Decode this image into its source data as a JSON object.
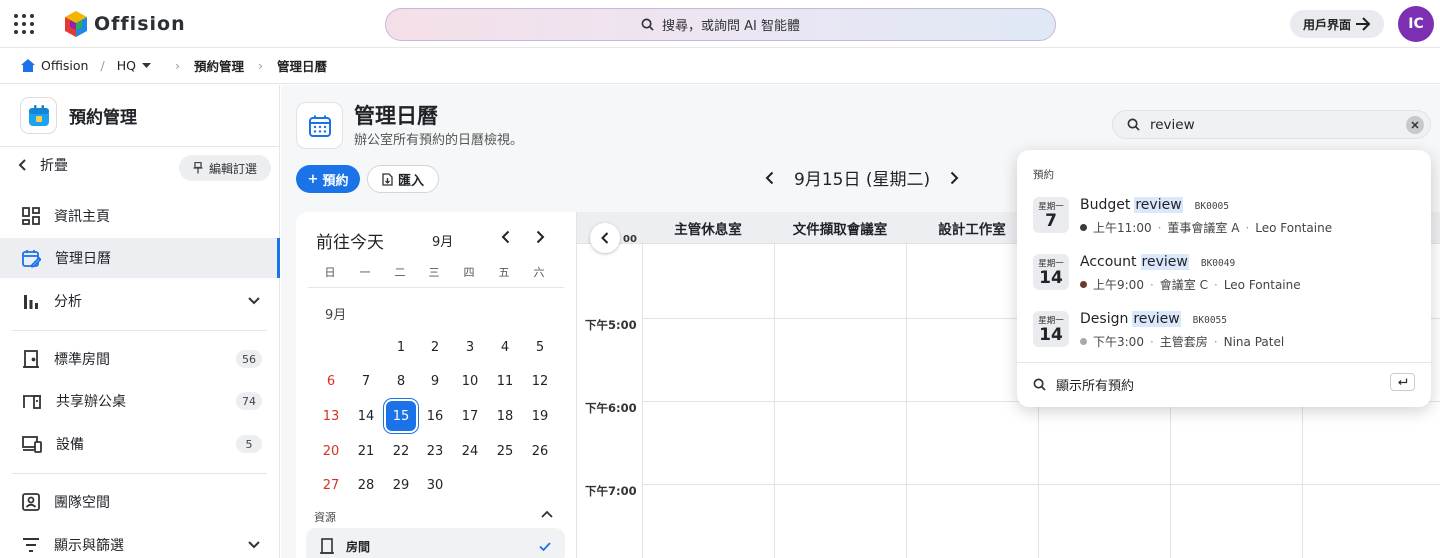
{
  "app": {
    "name": "Offision"
  },
  "global_search": {
    "placeholder": "搜尋，或詢問 AI 智能體"
  },
  "user_view_button": "用戶界面",
  "avatar_initials": "IC",
  "breadcrumb": {
    "home": "Offision",
    "location": "HQ",
    "section": "預約管理",
    "page": "管理日曆"
  },
  "sidebar": {
    "title": "預約管理",
    "collapse_label": "折疊",
    "pin_label": "編輯訂選",
    "nav": [
      {
        "label": "資訊主頁",
        "icon": "dashboard-icon"
      },
      {
        "label": "管理日曆",
        "icon": "calendar-edit-icon",
        "active": true
      },
      {
        "label": "分析",
        "icon": "bar-chart-icon"
      }
    ],
    "resources": [
      {
        "label": "標準房間",
        "count": "56",
        "icon": "door-icon"
      },
      {
        "label": "共享辦公桌",
        "count": "74",
        "icon": "desk-icon"
      },
      {
        "label": "設備",
        "count": "5",
        "icon": "devices-icon"
      }
    ],
    "team_space": "團隊空間",
    "display_filter": "顯示與篩選"
  },
  "page": {
    "title": "管理日曆",
    "subtitle": "辦公室所有預約的日曆檢視。",
    "book_button": "預約",
    "import_button": "匯入",
    "current_date": "9月15日 (星期二)"
  },
  "mini_calendar": {
    "today_label": "前往今天",
    "month": "9月",
    "month_label": "9月",
    "weekdays": [
      "日",
      "一",
      "二",
      "三",
      "四",
      "五",
      "六"
    ],
    "weeks": [
      [
        "",
        "",
        "1",
        "2",
        "3",
        "4",
        "5"
      ],
      [
        "6",
        "7",
        "8",
        "9",
        "10",
        "11",
        "12"
      ],
      [
        "13",
        "14",
        "15",
        "16",
        "17",
        "18",
        "19"
      ],
      [
        "20",
        "21",
        "22",
        "23",
        "24",
        "25",
        "26"
      ],
      [
        "27",
        "28",
        "29",
        "30",
        "",
        "",
        ""
      ]
    ],
    "selected": "15",
    "resources_label": "資源",
    "room_item": "房間"
  },
  "grid": {
    "columns": [
      "主管休息室",
      "文件擷取會議室",
      "設計工作室"
    ],
    "times": [
      "下午5:00",
      "下午6:00",
      "下午7:00"
    ],
    "partial_time": "00"
  },
  "search": {
    "query": "review",
    "section_label": "預約",
    "results": [
      {
        "weekday": "星期一",
        "day": "7",
        "pre": "Budget",
        "match": "review",
        "code": "BK0005",
        "time": "上午11:00",
        "room": "董事會議室 A",
        "person": "Leo Fontaine",
        "dot": "#3b3b3b"
      },
      {
        "weekday": "星期一",
        "day": "14",
        "pre": "Account",
        "match": "review",
        "code": "BK0049",
        "time": "上午9:00",
        "room": "會議室 C",
        "person": "Leo Fontaine",
        "dot": "#6b3b2a"
      },
      {
        "weekday": "星期一",
        "day": "14",
        "pre": "Design",
        "match": "review",
        "code": "BK0055",
        "time": "下午3:00",
        "room": "主管套房",
        "person": "Nina Patel",
        "dot": "#a9a9a9"
      }
    ],
    "show_all": "顯示所有預約"
  },
  "colors": {
    "accent": "#1a73e8",
    "avatar": "#7d2fb4",
    "sunday": "#d93025"
  }
}
